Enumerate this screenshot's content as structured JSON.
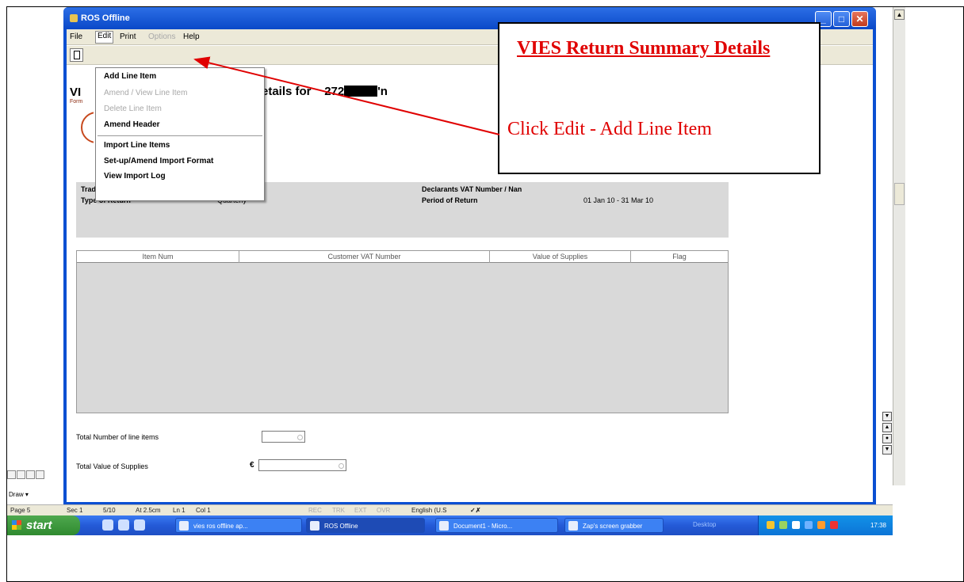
{
  "window": {
    "title": "ROS Offline",
    "buttons": {
      "minimize": "_",
      "maximize": "□",
      "close": "✕"
    }
  },
  "menubar": {
    "file": "File",
    "edit": "Edit",
    "print": "Print",
    "options": "Options",
    "help": "Help"
  },
  "edit_menu": {
    "items": [
      {
        "label": "Add Line Item",
        "enabled": true
      },
      {
        "label": "Amend / View Line Item",
        "enabled": false
      },
      {
        "label": "Delete Line Item",
        "enabled": false
      },
      {
        "label": "Amend Header",
        "enabled": true
      },
      {
        "label": "Import Line Items",
        "enabled": true
      },
      {
        "label": "Set-up/Amend Import Format",
        "enabled": true
      },
      {
        "label": "View Import Log",
        "enabled": true
      }
    ]
  },
  "form": {
    "heading_prefix": "VI",
    "heading_partial": "etails for",
    "heading_number": "272",
    "heading_suffix": "'n",
    "sub": "Form",
    "header": {
      "traders_vat_label": "Traders VAT Number",
      "type_of_return_label": "Type of Return",
      "type_of_return_value": "Quarterly",
      "declarants_vat_label": "Declarants VAT Number / Nan",
      "period_label": "Period of Return",
      "period_value": "01 Jan 10 - 31 Mar 10"
    },
    "table": {
      "columns": [
        "Item Num",
        "Customer VAT Number",
        "Value of Supplies",
        "Flag"
      ],
      "rows": []
    },
    "totals": {
      "line_items_label": "Total Number of line items",
      "value_label": "Total Value of Supplies",
      "currency": "€"
    }
  },
  "word": {
    "status": [
      "Page 5",
      "Sec 1",
      "5/10",
      "At 2.5cm",
      "Ln 1",
      "Col 1",
      "REC",
      "TRK",
      "EXT",
      "OVR",
      "English (U.S"
    ],
    "draw_label": "Draw ▾"
  },
  "taskbar": {
    "start": "start",
    "buttons": [
      "vies ros offline ap...",
      "ROS Offline",
      "Document1 - Micro...",
      "Zap's screen grabber"
    ],
    "desktop": "Desktop",
    "clock": "17:38"
  },
  "callout": {
    "title": "VIES Return Summary Details",
    "body": "Click Edit - Add Line Item"
  }
}
